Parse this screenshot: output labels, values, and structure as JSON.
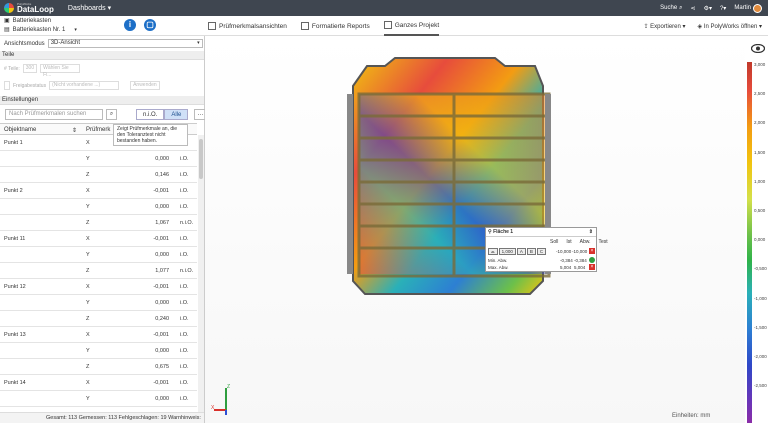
{
  "topbar": {
    "logo_small": "PolyWorks",
    "logo_big": "DataLoop",
    "menu": "Dashboards",
    "search": "Suche",
    "user": "Martin"
  },
  "project": {
    "name": "Batteriekasten",
    "item": "Batteriekasten Nr. 1"
  },
  "tabs": [
    {
      "label": "Prüfmerkmalsansichten"
    },
    {
      "label": "Formatierte Reports"
    },
    {
      "label": "Ganzes Projekt"
    }
  ],
  "actions": {
    "export": "Exportieren",
    "open": "In PolyWorks öffnen"
  },
  "left": {
    "mode_label": "Ansichtsmodus",
    "mode_value": "3D-Ansicht",
    "parts_header": "Teile",
    "parts_count_label": "# Teile:",
    "parts_count": "300",
    "parts_select": "Wählen Sie Fi...",
    "release_label": "Freigabestatus",
    "release_select": "(Nicht vorhandene ...)",
    "apply": "Anwenden",
    "settings_header": "Einstellungen",
    "search_placeholder": "Nach Prüfmerkmalen suchen",
    "filter_nio": "n.i.O.",
    "filter_all": "Alle",
    "tooltip": "Zeigt Prüfmerkmale an, die den Toleranztest nicht bestanden haben.",
    "col_name": "Objektname",
    "col_feature": "Prüfmerk",
    "rows": [
      {
        "name": "Punkt 1",
        "axis": "X",
        "value": "0,000",
        "status": "i.O."
      },
      {
        "name": "",
        "axis": "Y",
        "value": "0,000",
        "status": "i.O."
      },
      {
        "name": "",
        "axis": "Z",
        "value": "0,146",
        "status": "i.O."
      },
      {
        "name": "Punkt 2",
        "axis": "X",
        "value": "-0,001",
        "status": "i.O."
      },
      {
        "name": "",
        "axis": "Y",
        "value": "0,000",
        "status": "i.O."
      },
      {
        "name": "",
        "axis": "Z",
        "value": "1,067",
        "status": "n.i.O."
      },
      {
        "name": "Punkt 11",
        "axis": "X",
        "value": "-0,001",
        "status": "i.O."
      },
      {
        "name": "",
        "axis": "Y",
        "value": "0,000",
        "status": "i.O."
      },
      {
        "name": "",
        "axis": "Z",
        "value": "1,077",
        "status": "n.i.O."
      },
      {
        "name": "Punkt 12",
        "axis": "X",
        "value": "-0,001",
        "status": "i.O."
      },
      {
        "name": "",
        "axis": "Y",
        "value": "0,000",
        "status": "i.O."
      },
      {
        "name": "",
        "axis": "Z",
        "value": "0,240",
        "status": "i.O."
      },
      {
        "name": "Punkt 13",
        "axis": "X",
        "value": "-0,001",
        "status": "i.O."
      },
      {
        "name": "",
        "axis": "Y",
        "value": "0,000",
        "status": "i.O."
      },
      {
        "name": "",
        "axis": "Z",
        "value": "0,675",
        "status": "i.O."
      },
      {
        "name": "Punkt 14",
        "axis": "X",
        "value": "-0,001",
        "status": "i.O."
      },
      {
        "name": "",
        "axis": "Y",
        "value": "0,000",
        "status": "i.O."
      }
    ],
    "status": "Gesamt: 113 Gemessen: 113 Fehlgeschlagen: 19 Warnhinweis: 5"
  },
  "popup": {
    "title": "Fläche 1",
    "col_soll": "Soll",
    "col_ist": "Ist",
    "col_abw": "Abw.",
    "col_test": "Test",
    "ctrl_value": "1,000",
    "ctrl_a": "A",
    "ctrl_b": "B",
    "ctrl_c": "C",
    "row0_soll": "-10,000",
    "row0_ist": "-10,000",
    "min_label": "Min. Abw.",
    "min_soll": "-0,384",
    "min_ist": "-0,384",
    "max_label": "Max. Abw.",
    "max_soll": "5,004",
    "max_ist": "5,004"
  },
  "viewport": {
    "units": "Einheiten: mm",
    "axis_x": "X",
    "axis_z": "Z"
  },
  "colorbar": {
    "labels": [
      "3,000",
      "2,500",
      "2,000",
      "1,500",
      "1,000",
      "0,500",
      "0,000",
      "-0,500",
      "-1,000",
      "-1,500",
      "-2,000",
      "-2,500"
    ]
  }
}
